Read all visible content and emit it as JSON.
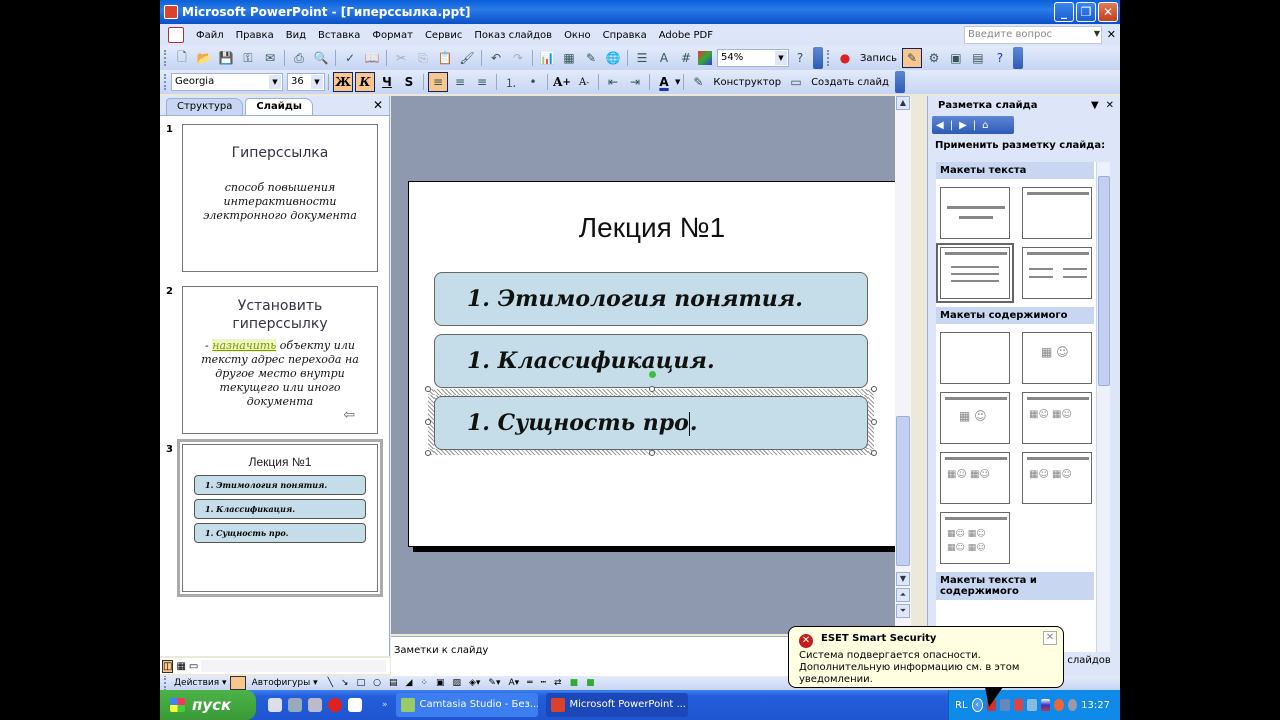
{
  "window": {
    "title": "Microsoft PowerPoint - [Гиперссылка.ppt]"
  },
  "menu": {
    "items": [
      "Файл",
      "Правка",
      "Вид",
      "Вставка",
      "Формат",
      "Сервис",
      "Показ слайдов",
      "Окно",
      "Справка",
      "Adobe PDF"
    ],
    "help_placeholder": "Введите вопрос"
  },
  "standard_toolbar": {
    "zoom": "54%",
    "record_label": "Запись"
  },
  "format_toolbar": {
    "font": "Georgia",
    "size": "36",
    "bold": "Ж",
    "italic": "К",
    "underline": "Ч",
    "shadow": "S",
    "designer_label": "Конструктор",
    "new_slide_label": "Создать слайд"
  },
  "left_pane": {
    "tabs": [
      "Структура",
      "Слайды"
    ],
    "selected_tab": "Слайды",
    "slides": [
      {
        "number": "1",
        "title": "Гиперссылка",
        "body": "способ повышения интерактивности электронного документа"
      },
      {
        "number": "2",
        "title": "Установить гиперссылку",
        "link_word": "назначить",
        "body": " объекту или тексту адрес перехода на другое место внутри текущего или иного документа"
      },
      {
        "number": "3",
        "title": "Лекция №1",
        "items": [
          "1. Этимология понятия.",
          "1. Классификация.",
          "1. Сущность про."
        ]
      }
    ]
  },
  "slide": {
    "title": "Лекция №1",
    "items": [
      "1. Этимология понятия.",
      "1. Классификация.",
      "1. Сущность про"
    ],
    "cursor_suffix": "."
  },
  "notes": {
    "placeholder": "Заметки к слайду"
  },
  "task_pane": {
    "title": "Разметка слайда",
    "apply_label": "Применить разметку слайда:",
    "sections": [
      "Макеты текста",
      "Макеты содержимого",
      "Макеты текста и содержимого"
    ],
    "footer_partial": "е слайдов"
  },
  "drawing_toolbar": {
    "actions_label": "Действия",
    "autoshapes_label": "Автофигуры"
  },
  "taskbar": {
    "start_label": "пуск",
    "tasks": [
      "Camtasia Studio - Без...",
      "Microsoft PowerPoint ..."
    ],
    "language": "RL",
    "clock": "13:27"
  },
  "balloon": {
    "title": "ESET Smart Security",
    "text": "Система подвергается опасности. Дополнительную информацию см. в этом уведомлении."
  }
}
